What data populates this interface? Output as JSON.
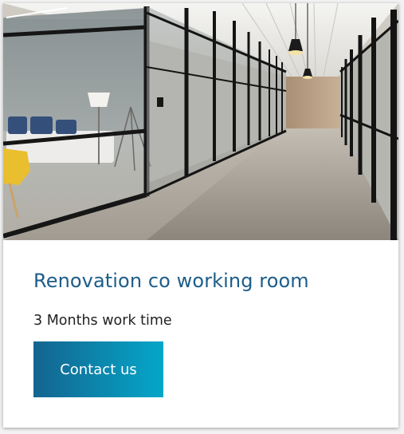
{
  "card": {
    "image_alt": "Glass-walled office corridor",
    "title": "Renovation co working room",
    "subtitle": "3 Months work time",
    "button_label": "Contact us"
  },
  "colors": {
    "title": "#1c5d8a",
    "button_start": "#14648f",
    "button_end": "#04a7c9"
  }
}
